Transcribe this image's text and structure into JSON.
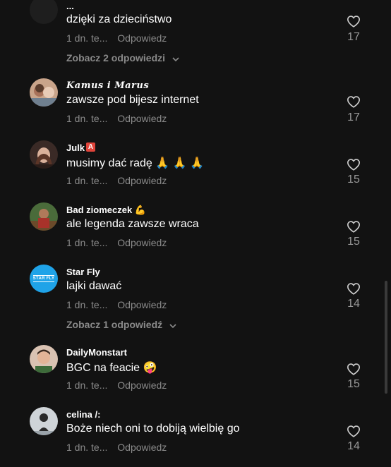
{
  "comments": [
    {
      "user": "...",
      "text": "dzięki za dzieciństwo",
      "time": "1 dn. te...",
      "reply": "Odpowiedz",
      "likes": "17",
      "more": "Zobacz 2 odpowiedzi"
    },
    {
      "user": "𝑲𝒂𝒎𝒖𝒔 𝒊 𝑴𝒂𝒓𝒖𝒔",
      "text": "zawsze pod bijesz internet",
      "time": "1 dn. te...",
      "reply": "Odpowiedz",
      "likes": "17"
    },
    {
      "user": "Julk",
      "user_badge": "A",
      "text": "musimy dać radę 🙏 🙏 🙏",
      "time": "1 dn. te...",
      "reply": "Odpowiedz",
      "likes": "15"
    },
    {
      "user": "Bad ziomeczek 💪",
      "text": "ale legenda zawsze wraca",
      "time": "1 dn. te...",
      "reply": "Odpowiedz",
      "likes": "15"
    },
    {
      "user": "Star Fly",
      "avatar_text": "STAR FLY",
      "text": "lajki dawać",
      "time": "1 dn. te...",
      "reply": "Odpowiedz",
      "likes": "14",
      "more": "Zobacz 1 odpowiedź"
    },
    {
      "user": "DailyMonstart",
      "text": "BGC na feacie 🤪",
      "time": "1 dn. te...",
      "reply": "Odpowiedz",
      "likes": "15"
    },
    {
      "user": "celina /:",
      "text": "Boże niech oni to dobiją wielbię go",
      "time": "1 dn. te...",
      "reply": "Odpowiedz",
      "likes": "14"
    }
  ],
  "colors": {
    "background": "#121212",
    "muted": "#8a8a8a",
    "text": "#ffffff"
  }
}
